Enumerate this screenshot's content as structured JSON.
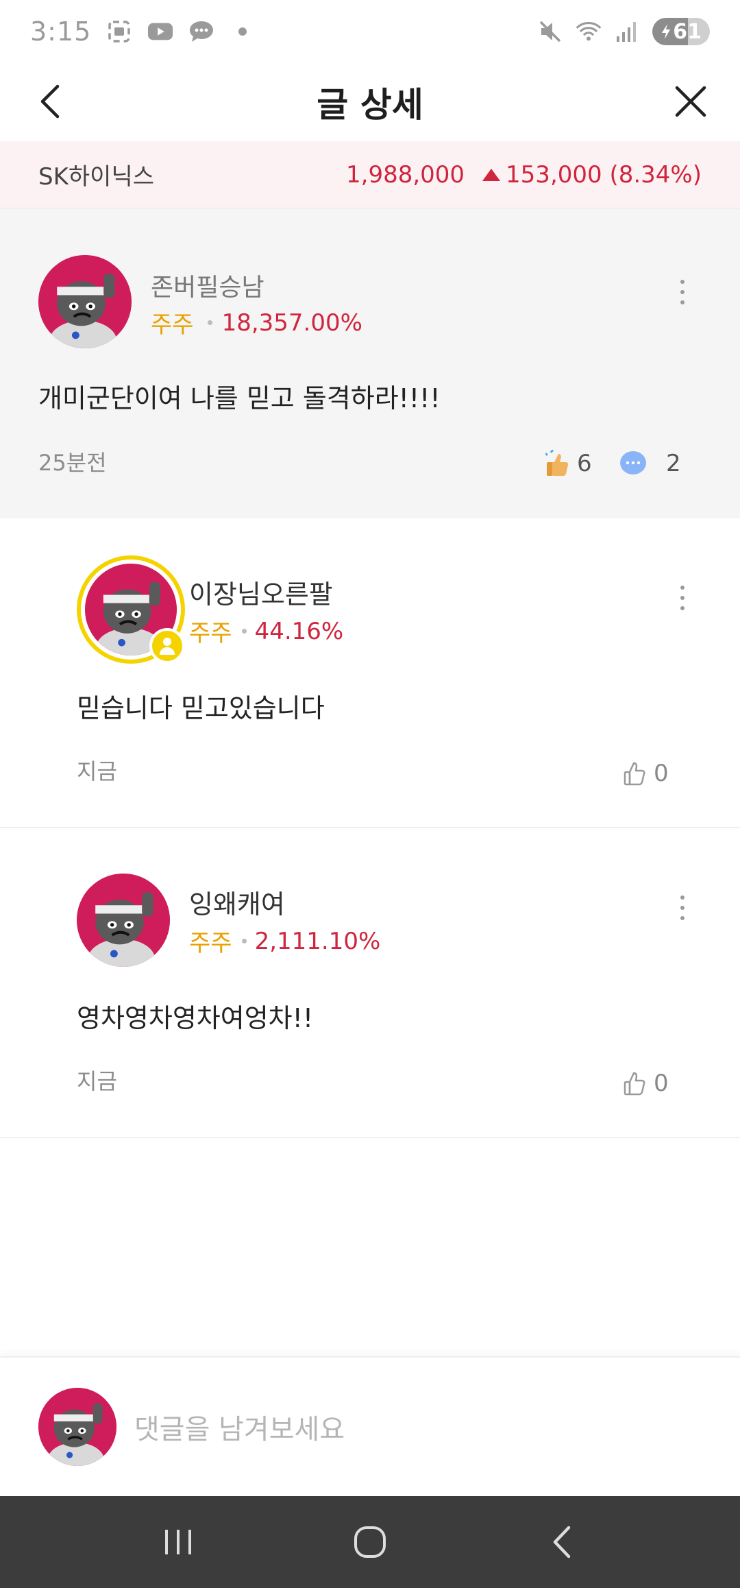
{
  "status_bar": {
    "time": "3:15",
    "battery": "61",
    "icons": [
      "screenshot-icon",
      "youtube-icon",
      "message-icon",
      "dot-icon",
      "mute-icon",
      "wifi-icon",
      "signal-icon",
      "battery-charging-icon"
    ]
  },
  "header": {
    "title": "글 상세",
    "back_icon": "chevron-left-icon",
    "close_icon": "close-icon"
  },
  "stock": {
    "name": "SK하이닉스",
    "price": "1,988,000",
    "change": "153,000 (8.34%)",
    "trend": "up",
    "color": "#d0253e"
  },
  "post": {
    "author": "존버필승남",
    "badge": "주주",
    "return_rate": "18,357.00%",
    "text": "개미군단이여 나를 믿고 돌격하라!!!!",
    "time": "25분전",
    "likes": "6",
    "comments": "2"
  },
  "comments": [
    {
      "author": "이장님오른팔",
      "badge": "주주",
      "return_rate": "44.16%",
      "text": "믿습니다 믿고있습니다",
      "time": "지금",
      "likes": "0",
      "is_me": true
    },
    {
      "author": "잉왜캐여",
      "badge": "주주",
      "return_rate": "2,111.10%",
      "text": "영차영차영차여엉차!!",
      "time": "지금",
      "likes": "0",
      "is_me": false
    }
  ],
  "composer": {
    "placeholder": "댓글을 남겨보세요"
  },
  "colors": {
    "up_red": "#d0253e",
    "holder_gold": "#e9a100",
    "avatar_bg": "#cf1c5a",
    "my_ring": "#f5d300"
  }
}
